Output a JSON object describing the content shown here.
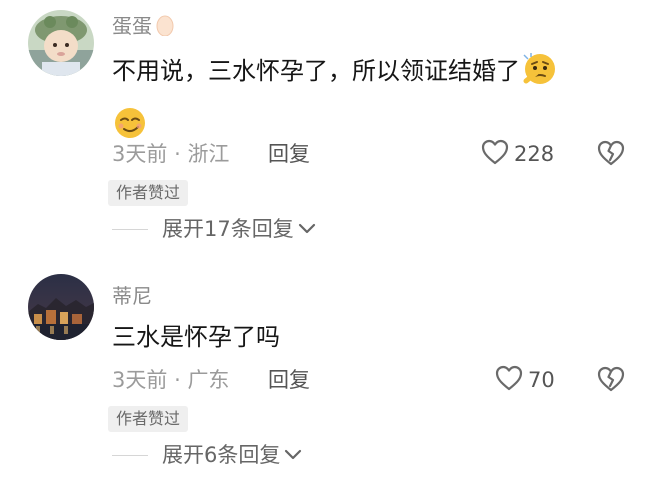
{
  "comments": [
    {
      "username": "蛋蛋",
      "username_emoji": "egg-icon",
      "text": "不用说，三水怀孕了，所以领证结婚了",
      "emojis": [
        "thinking-face-icon",
        "smirk-face-icon"
      ],
      "time": "3天前",
      "separator": "·",
      "location": "浙江",
      "reply_label": "回复",
      "like_count": "228",
      "badge": "作者赞过",
      "expand_label": "展开17条回复"
    },
    {
      "username": "蒂尼",
      "text": "三水是怀孕了吗",
      "time": "3天前",
      "separator": "·",
      "location": "广东",
      "reply_label": "回复",
      "like_count": "70",
      "badge": "作者赞过",
      "expand_label": "展开6条回复"
    }
  ],
  "colors": {
    "meta_text": "#9b9b9b",
    "name_text": "#8a8a8a",
    "body_text": "#161616",
    "badge_bg": "#efefef",
    "emoji_yellow": "#f6c23a"
  }
}
